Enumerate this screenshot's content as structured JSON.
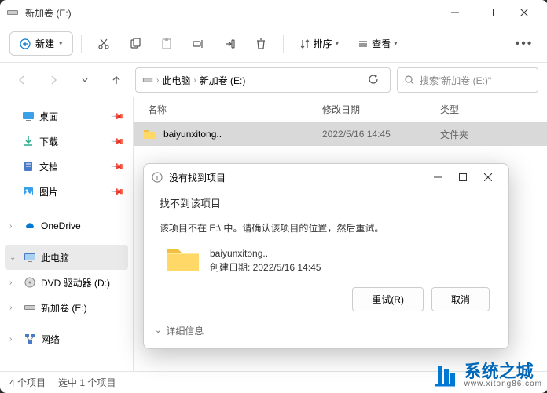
{
  "window": {
    "title": "新加卷 (E:)"
  },
  "toolbar": {
    "new_label": "新建",
    "sort_label": "排序",
    "view_label": "查看"
  },
  "address": {
    "seg1": "此电脑",
    "seg2": "新加卷 (E:)"
  },
  "search": {
    "placeholder": "搜索\"新加卷 (E:)\""
  },
  "sidebar": {
    "desktop": "桌面",
    "downloads": "下载",
    "documents": "文档",
    "pictures": "图片",
    "onedrive": "OneDrive",
    "thispc": "此电脑",
    "dvd": "DVD 驱动器 (D:)",
    "drive_e": "新加卷 (E:)",
    "network": "网络"
  },
  "columns": {
    "name": "名称",
    "date": "修改日期",
    "type": "类型"
  },
  "files": {
    "row0": {
      "name": "baiyunxitong..",
      "date": "2022/5/16 14:45",
      "type": "文件夹"
    }
  },
  "status": {
    "count": "4 个项目",
    "selected": "选中 1 个项目"
  },
  "dialog": {
    "title": "没有找到项目",
    "heading": "找不到该项目",
    "msg": "该项目不在 E:\\ 中。请确认该项目的位置，然后重试。",
    "item_name": "baiyunxitong..",
    "item_date": "创建日期: 2022/5/16 14:45",
    "retry": "重试(R)",
    "cancel": "取消",
    "details": "详细信息"
  },
  "watermark": {
    "text": "系统之城",
    "url": "www.xitong86.com"
  }
}
